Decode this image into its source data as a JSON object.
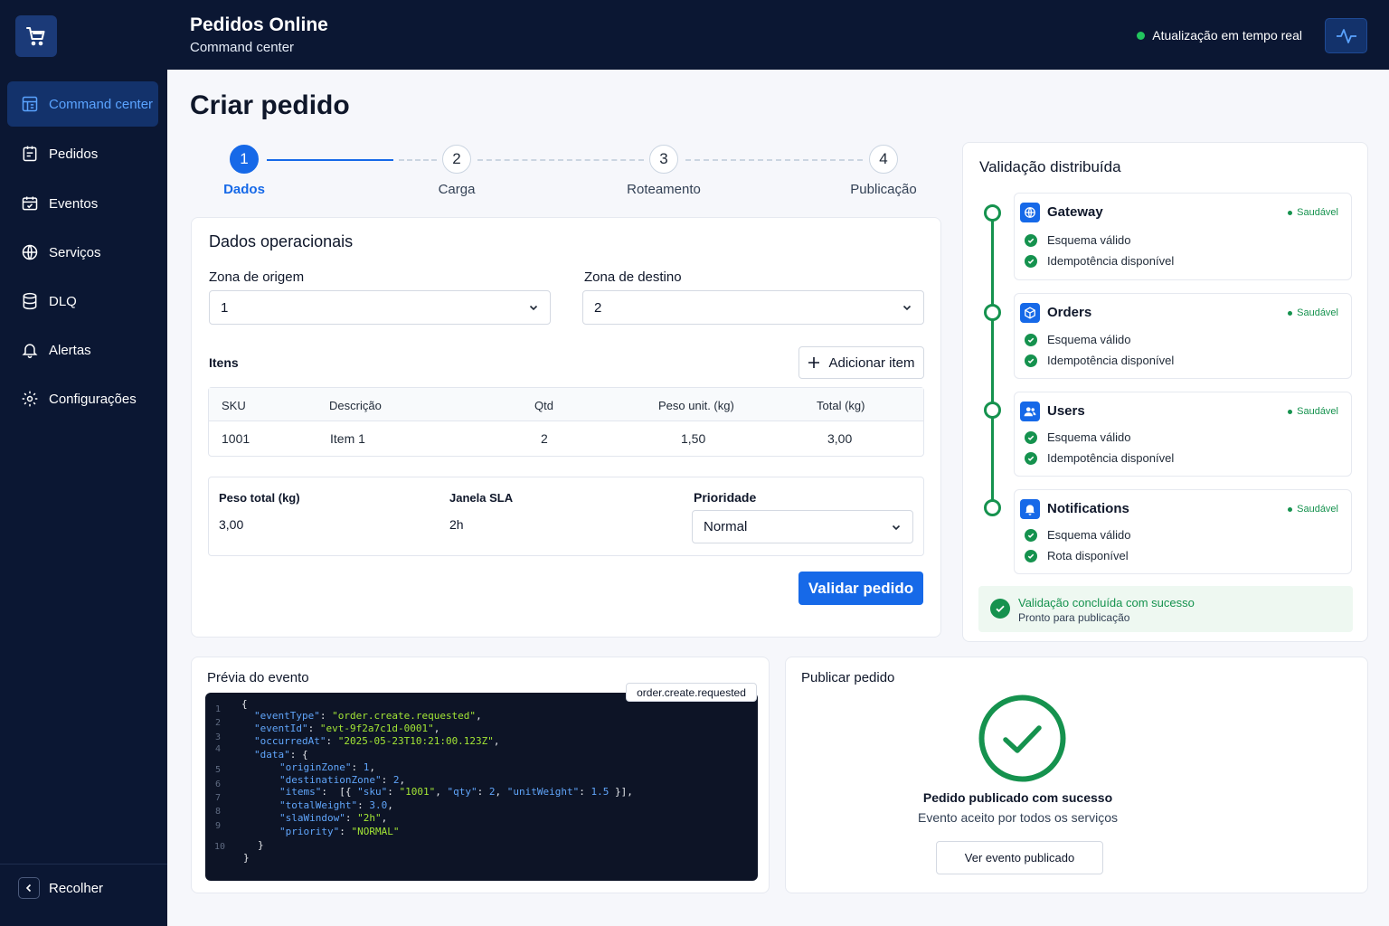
{
  "app": {
    "title": "Pedidos Online",
    "subtitle": "Command center"
  },
  "header": {
    "realtime_label": "Atualização em tempo real",
    "pulse_icon": "activity-icon"
  },
  "sidebar": {
    "items": [
      {
        "label": "Command center",
        "icon": "dashboard-icon",
        "active": true
      },
      {
        "label": "Pedidos",
        "icon": "orders-icon"
      },
      {
        "label": "Eventos",
        "icon": "events-icon"
      },
      {
        "label": "Serviços",
        "icon": "globe-icon"
      },
      {
        "label": "DLQ",
        "icon": "database-icon"
      },
      {
        "label": "Alertas",
        "icon": "bell-icon"
      },
      {
        "label": "Configurações",
        "icon": "gear-icon"
      }
    ],
    "collapse_label": "Recolher"
  },
  "page": {
    "title": "Criar pedido"
  },
  "stepper": [
    {
      "num": "1",
      "label": "Dados",
      "active": true
    },
    {
      "num": "2",
      "label": "Carga"
    },
    {
      "num": "3",
      "label": "Roteamento"
    },
    {
      "num": "4",
      "label": "Publicação"
    }
  ],
  "form": {
    "title": "Dados operacionais",
    "origin_label": "Zona de origem",
    "origin_value": "1",
    "dest_label": "Zona de destino",
    "dest_value": "2",
    "items_label": "Itens",
    "add_item_label": "Adicionar item",
    "columns": [
      "SKU",
      "Descrição",
      "Qtd",
      "Peso unit. (kg)",
      "Total (kg)"
    ],
    "rows": [
      [
        "1001",
        "Item 1",
        "2",
        "1,50",
        "3,00"
      ]
    ],
    "total_weight_label": "Peso total (kg)",
    "total_weight_value": "3,00",
    "sla_label": "Janela SLA",
    "sla_value": "2h",
    "priority_label": "Prioridade",
    "priority_value": "Normal",
    "validate_label": "Validar pedido"
  },
  "validation": {
    "title": "Validação distribuída",
    "services": [
      {
        "name": "Gateway",
        "icon": "globe-icon",
        "status": "Saudável",
        "checks": [
          "Esquema válido",
          "Idempotência disponível"
        ]
      },
      {
        "name": "Orders",
        "icon": "box-icon",
        "status": "Saudável",
        "checks": [
          "Esquema válido",
          "Idempotência disponível"
        ]
      },
      {
        "name": "Users",
        "icon": "users-icon",
        "status": "Saudável",
        "checks": [
          "Esquema válido",
          "Idempotência disponível"
        ]
      },
      {
        "name": "Notifications",
        "icon": "bell-icon",
        "status": "Saudável",
        "checks": [
          "Esquema válido",
          "Rota disponível"
        ]
      }
    ],
    "result_title": "Validação concluída com sucesso",
    "result_sub": "Pronto para publicação"
  },
  "preview": {
    "title": "Prévia do evento",
    "tag": "order.create.requested",
    "line_numbers": [
      "1",
      "2",
      "3",
      "4",
      "5",
      "6",
      "7",
      "8",
      "9",
      "10"
    ]
  },
  "publish": {
    "title": "Publicar pedido",
    "success_title": "Pedido publicado com sucesso",
    "success_sub": "Evento aceito por todos os serviços",
    "view_label": "Ver evento publicado"
  },
  "colors": {
    "primary": "#1669e8",
    "success": "#15924e",
    "navy": "#0b1733"
  }
}
